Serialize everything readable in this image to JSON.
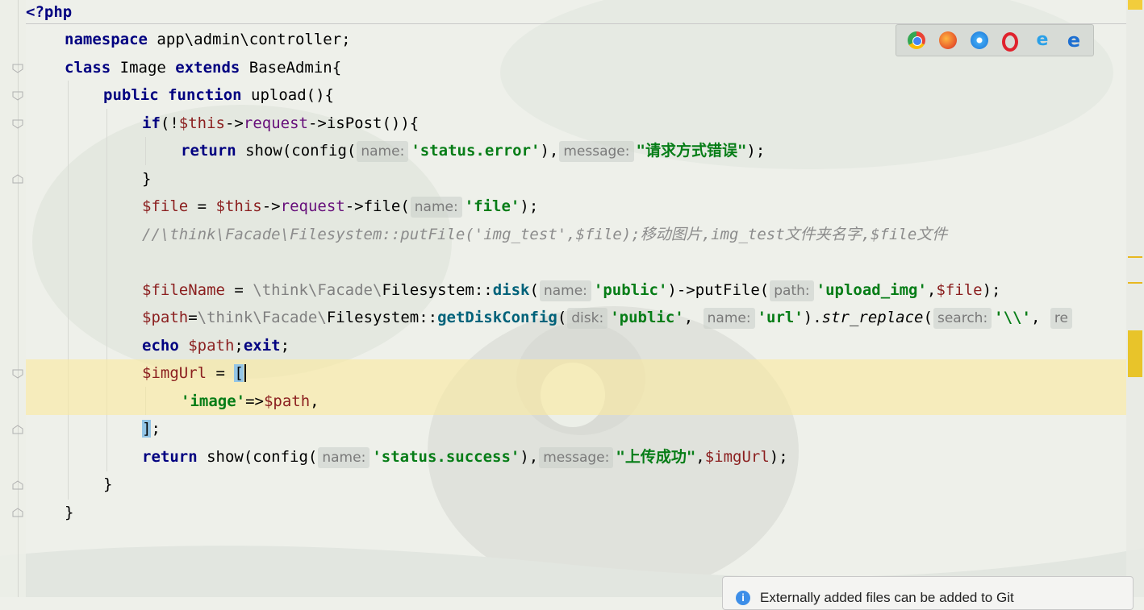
{
  "editor": {
    "lines": {
      "l1": "<?php",
      "l2_kw": "namespace",
      "l2_rest": " app\\admin\\controller;",
      "l3_kw1": "class",
      "l3_name": " Image ",
      "l3_kw2": "extends",
      "l3_rest": " BaseAdmin{",
      "l4_kw1": "public",
      "l4_kw2": "function",
      "l4_rest": " upload(){",
      "l5_if": "if",
      "l5_a": "(!",
      "l5_this": "$this",
      "l5_arrow": "->",
      "l5_request": "request",
      "l5_rest": "->isPost()){",
      "l6_ret": "return",
      "l6_a": " show(config(",
      "l6_hint1": "name:",
      "l6_str1": "'status.error'",
      "l6_b": "),",
      "l6_hint2": "message:",
      "l6_str2": "\"请求方式错误\"",
      "l6_c": ");",
      "l7": "}",
      "l8_file": "$file",
      "l8_a": " = ",
      "l8_this": "$this",
      "l8_arrow": "->",
      "l8_request": "request",
      "l8_b": "->file(",
      "l8_hint": "name:",
      "l8_str": "'file'",
      "l8_c": ");",
      "l9": "//\\think\\Facade\\Filesystem::putFile('img_test',$file);移动图片,img_test文件夹名字,$file文件",
      "l11_var": "$fileName",
      "l11_a": " = ",
      "l11_ns": "\\think\\Facade\\",
      "l11_cls": "Filesystem::",
      "l11_disk": "disk",
      "l11_b": "(",
      "l11_hint1": "name:",
      "l11_str1": "'public'",
      "l11_c": ")->putFile(",
      "l11_hint2": "path:",
      "l11_str2": "'upload_img'",
      "l11_d": ",",
      "l11_file": "$file",
      "l11_e": ");",
      "l12_var": "$path",
      "l12_a": "=",
      "l12_ns": "\\think\\Facade\\",
      "l12_cls": "Filesystem::",
      "l12_m": "getDiskConfig",
      "l12_b": "(",
      "l12_hint1": "disk:",
      "l12_str1": "'public'",
      "l12_c": ", ",
      "l12_hint2": "name:",
      "l12_str2": "'url'",
      "l12_d": ").",
      "l12_fn": "str_replace",
      "l12_e": "(",
      "l12_hint3": "search:",
      "l12_str3": "'\\\\'",
      "l12_f": ", ",
      "l12_hint4": "re",
      "l13_echo": "echo",
      "l13_var": " $path",
      "l13_semi": ";",
      "l13_exit": "exit",
      "l13_end": ";",
      "l14_var": "$imgUrl",
      "l14_a": " = ",
      "l14_br": "[",
      "l15_str": "'image'",
      "l15_a": "=>",
      "l15_var": "$path",
      "l15_b": ",",
      "l16_br": "]",
      "l16_semi": ";",
      "l17_ret": "return",
      "l17_a": " show(config(",
      "l17_hint1": "name:",
      "l17_str1": "'status.success'",
      "l17_b": "),",
      "l17_hint2": "message:",
      "l17_str2": "\"上传成功\"",
      "l17_c": ",",
      "l17_var": "$imgUrl",
      "l17_d": ");",
      "l18": "}",
      "l19": "}"
    }
  },
  "browser_icons": [
    "chrome-icon",
    "firefox-icon",
    "safari-icon",
    "opera-icon",
    "ie-icon",
    "edge-icon"
  ],
  "notification": {
    "text": "Externally added files can be added to Git"
  },
  "colors": {
    "highlight": "#faeaa0",
    "keyword": "#000080",
    "string": "#067d17"
  }
}
